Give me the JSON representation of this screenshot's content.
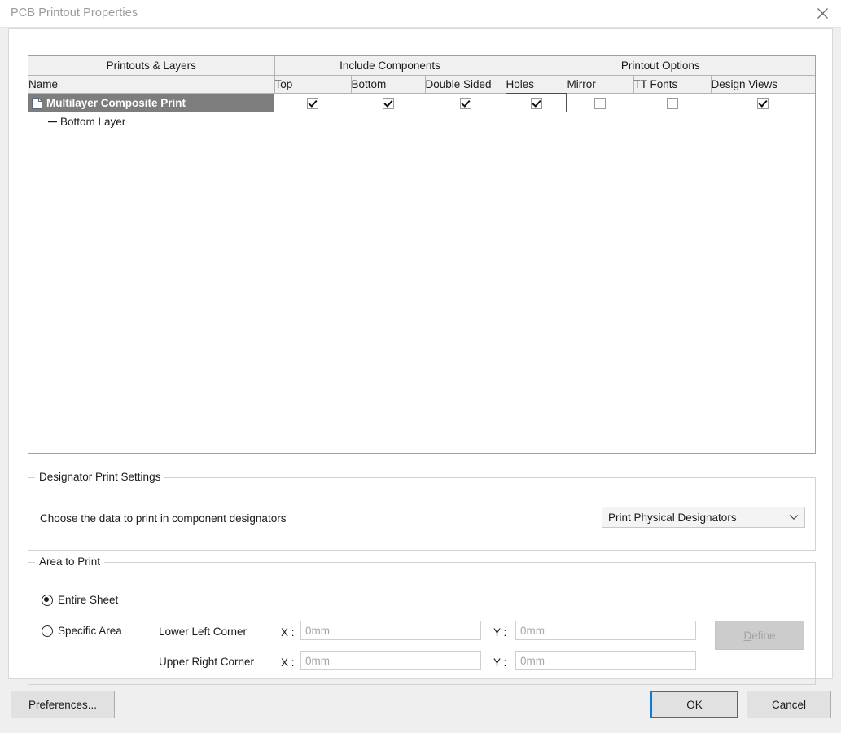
{
  "window": {
    "title": "PCB Printout Properties",
    "close_icon": "close-icon"
  },
  "table": {
    "group_headers": [
      {
        "label": "Printouts & Layers",
        "span": 1
      },
      {
        "label": "Include Components",
        "span": 3
      },
      {
        "label": "Printout Options",
        "span": 4
      }
    ],
    "columns": [
      "Name",
      "Top",
      "Bottom",
      "Double Sided",
      "Holes",
      "Mirror",
      "TT Fonts",
      "Design Views"
    ],
    "rows": [
      {
        "name": "Multilayer Composite Print",
        "level": 0,
        "selected": true,
        "icon": "document-icon",
        "top": true,
        "bottom": true,
        "double_sided": true,
        "holes": true,
        "holes_focused": true,
        "mirror": false,
        "tt_fonts": false,
        "design_views": true
      },
      {
        "name": "Bottom Layer",
        "level": 1,
        "selected": false,
        "icon": "layer-dash-icon",
        "top": null,
        "bottom": null,
        "double_sided": null,
        "holes": null,
        "holes_focused": false,
        "mirror": null,
        "tt_fonts": null,
        "design_views": null
      }
    ]
  },
  "designator_group": {
    "title": "Designator Print Settings",
    "label": "Choose the data to print in component designators",
    "dropdown": {
      "value": "Print Physical Designators",
      "arrow_icon": "chevron-down-icon"
    }
  },
  "area_group": {
    "title": "Area to Print",
    "radios": [
      {
        "label": "Entire Sheet",
        "selected": true
      },
      {
        "label": "Specific Area",
        "selected": false
      }
    ],
    "corners": [
      {
        "label": "Lower Left Corner",
        "x_label": "X :",
        "x_placeholder": "0mm",
        "x_value": "",
        "y_label": "Y :",
        "y_placeholder": "0mm",
        "y_value": ""
      },
      {
        "label": "Upper Right Corner",
        "x_label": "X :",
        "x_placeholder": "0mm",
        "x_value": "",
        "y_label": "Y :",
        "y_placeholder": "0mm",
        "y_value": ""
      }
    ],
    "define_button": {
      "label": "Define",
      "mnemonic": "D",
      "rest": "efine",
      "enabled": false
    }
  },
  "footer": {
    "preferences_label": "Preferences...",
    "ok_label": "OK",
    "cancel_label": "Cancel"
  },
  "colors": {
    "accent_focus": "#0d7ad6",
    "selection": "#7d7d7d",
    "header_bg": "#f0f0f0",
    "window_bg": "#efefef",
    "panel_bg": "#ffffff",
    "disabled_text": "#a3a3a3"
  }
}
